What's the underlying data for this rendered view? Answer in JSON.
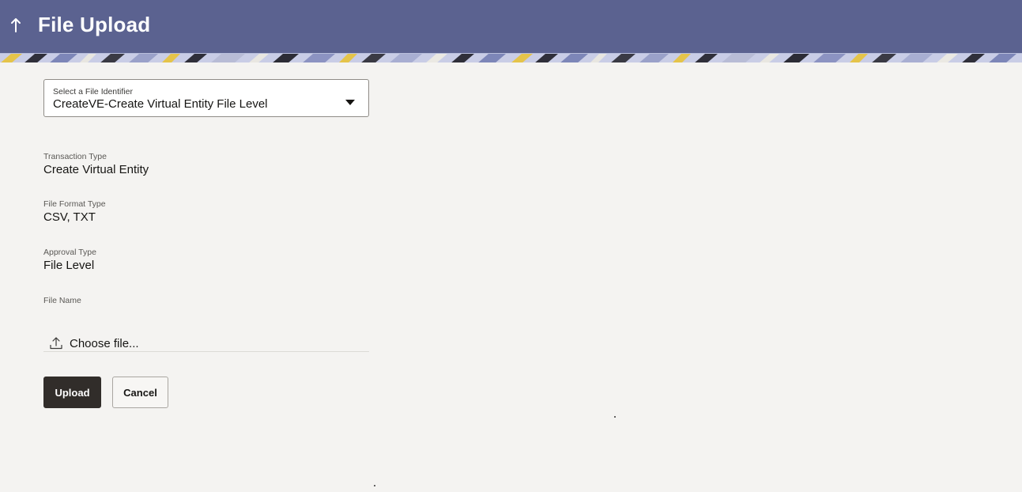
{
  "header": {
    "title": "File Upload",
    "back_icon": "arrow-up-icon",
    "background": "#5b6290"
  },
  "form": {
    "file_identifier": {
      "label": "Select a File Identifier",
      "value": "CreateVE-Create Virtual Entity File Level",
      "caret_icon": "caret-down-icon"
    },
    "fields": [
      {
        "label": "Transaction Type",
        "value": "Create Virtual Entity"
      },
      {
        "label": "File Format Type",
        "value": "CSV, TXT"
      },
      {
        "label": "Approval Type",
        "value": "File Level"
      }
    ],
    "file_name": {
      "label": "File Name",
      "chooser_text": "Choose file...",
      "icon": "upload-icon"
    }
  },
  "actions": {
    "upload_label": "Upload",
    "cancel_label": "Cancel"
  },
  "colors": {
    "primary_button": "#312d2a",
    "page_background": "#f4f3f1"
  }
}
